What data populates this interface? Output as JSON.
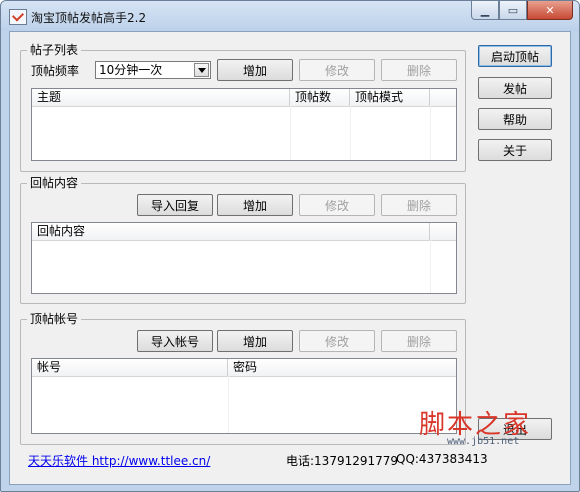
{
  "window": {
    "title": "淘宝顶帖发帖高手2.2"
  },
  "posts": {
    "legend": "帖子列表",
    "freq_label": "顶帖频率",
    "freq_value": "10分钟一次",
    "add": "增加",
    "edit": "修改",
    "delete": "删除",
    "columns": [
      "主题",
      "顶帖数",
      "顶帖模式"
    ]
  },
  "replies": {
    "legend": "回帖内容",
    "import": "导入回复",
    "add": "增加",
    "edit": "修改",
    "delete": "删除",
    "columns": [
      "回帖内容"
    ]
  },
  "accounts": {
    "legend": "顶帖帐号",
    "import": "导入帐号",
    "add": "增加",
    "edit": "修改",
    "delete": "删除",
    "columns": [
      "帐号",
      "密码"
    ]
  },
  "side": {
    "start": "启动顶帖",
    "post": "发帖",
    "help": "帮助",
    "about": "关于",
    "exit": "退出"
  },
  "footer": {
    "link": "天天乐软件 http://www.ttlee.cn/",
    "phone": "电话:13791291779",
    "qq": "QQ:437383413"
  },
  "watermark": {
    "text": "脚本之家",
    "url": "www.jb51.net"
  },
  "colors": {
    "titlebar": "#bcd1ea",
    "client": "#f0f0f0",
    "link": "#0000ee",
    "close": "#c64a35",
    "watermark": "#d9362a"
  }
}
